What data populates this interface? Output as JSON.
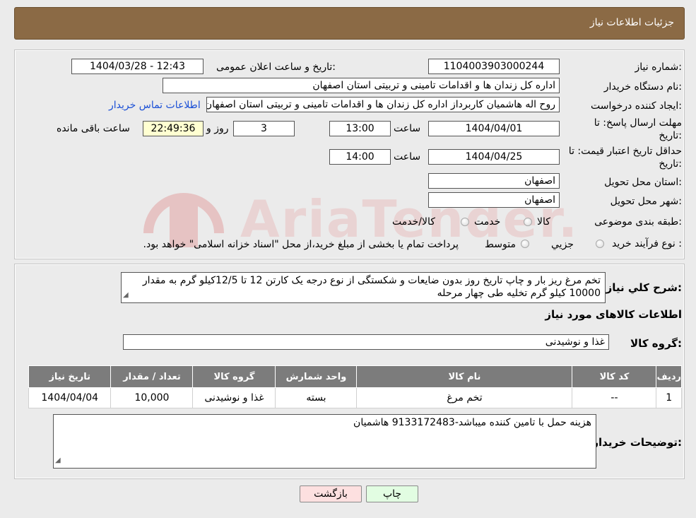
{
  "header": {
    "title": "جزئیات اطلاعات نیاز"
  },
  "fields": {
    "need_number_label": "شماره نیاز:",
    "need_number": "1104003903000244",
    "announce_label": "تاریخ و ساعت اعلان عمومی:",
    "announce_value": "1404/03/28 - 12:43",
    "buyer_org_label": "نام دستگاه خریدار:",
    "buyer_org": "اداره کل زندان ها و اقدامات تامینی و تربیتی استان اصفهان",
    "creator_label": "ایجاد کننده درخواست:",
    "creator": "روح اله هاشمیان کاربرداز اداره کل زندان ها و اقدامات تامینی و تربیتی استان اصفهان",
    "contact_link": "اطلاعات تماس خریدار",
    "deadline_label_1": "مهلت ارسال پاسخ: تا",
    "deadline_label_2": "تاریخ:",
    "deadline_date": "1404/04/01",
    "time_label": "ساعت",
    "deadline_time": "13:00",
    "days_value": "3",
    "days_label": "روز و",
    "remaining_time": "22:49:36",
    "remaining_label": "ساعت باقی مانده",
    "validity_label_1": "حداقل تاریخ اعتبار قیمت: تا",
    "validity_label_2": "تاریخ:",
    "validity_date": "1404/04/25",
    "validity_time": "14:00",
    "province_label": "استان محل تحویل:",
    "province": "اصفهان",
    "city_label": "شهر محل تحویل:",
    "city": "اصفهان",
    "category_label": "طبقه بندی موضوعی:",
    "category_options": [
      "کالا",
      "خدمت",
      "کالا/خدمت"
    ],
    "process_label": "نوع فرآیند خرید :",
    "process_options": [
      "جزیي",
      "متوسط"
    ],
    "process_note": "پرداخت تمام یا بخشی از مبلغ خرید،از محل \"اسناد خزانه اسلامی\" خواهد بود."
  },
  "description": {
    "label": "شرح کلي نياز:",
    "text": "تخم مرغ ریز بار و چاپ تاریخ روز بدون ضایعات و شکستگی از نوع درجه یک کارتن 12 تا 12/5کیلو گرم به مقدار 10000 کیلو گرم تخلیه طی چهار مرحله"
  },
  "goods_section": {
    "title": "اطلاعات کالاهای مورد نیاز",
    "group_label": "گروه کالا:",
    "group_value": "غذا و نوشیدنی"
  },
  "table": {
    "headers": [
      "ردیف",
      "کد کالا",
      "نام کالا",
      "واحد شمارش",
      "گروه کالا",
      "تعداد / مقدار",
      "تاریخ نیاز"
    ],
    "rows": [
      [
        "1",
        "--",
        "تخم مرغ",
        "بسته",
        "غذا و نوشیدنی",
        "10,000",
        "1404/04/04"
      ]
    ]
  },
  "buyer_notes": {
    "label": "توضیحات خریدار:",
    "text": "هزینه حمل با تامین کننده میباشد-9133172483 هاشمیان"
  },
  "buttons": {
    "print": "چاپ",
    "back": "بازگشت"
  },
  "watermark": {
    "text": "AriaTender.neT"
  },
  "colors": {
    "header": "#8b6a45",
    "table_header": "#7c7c7c",
    "highlight": "#ffffd1",
    "link": "#1a4fd6"
  }
}
